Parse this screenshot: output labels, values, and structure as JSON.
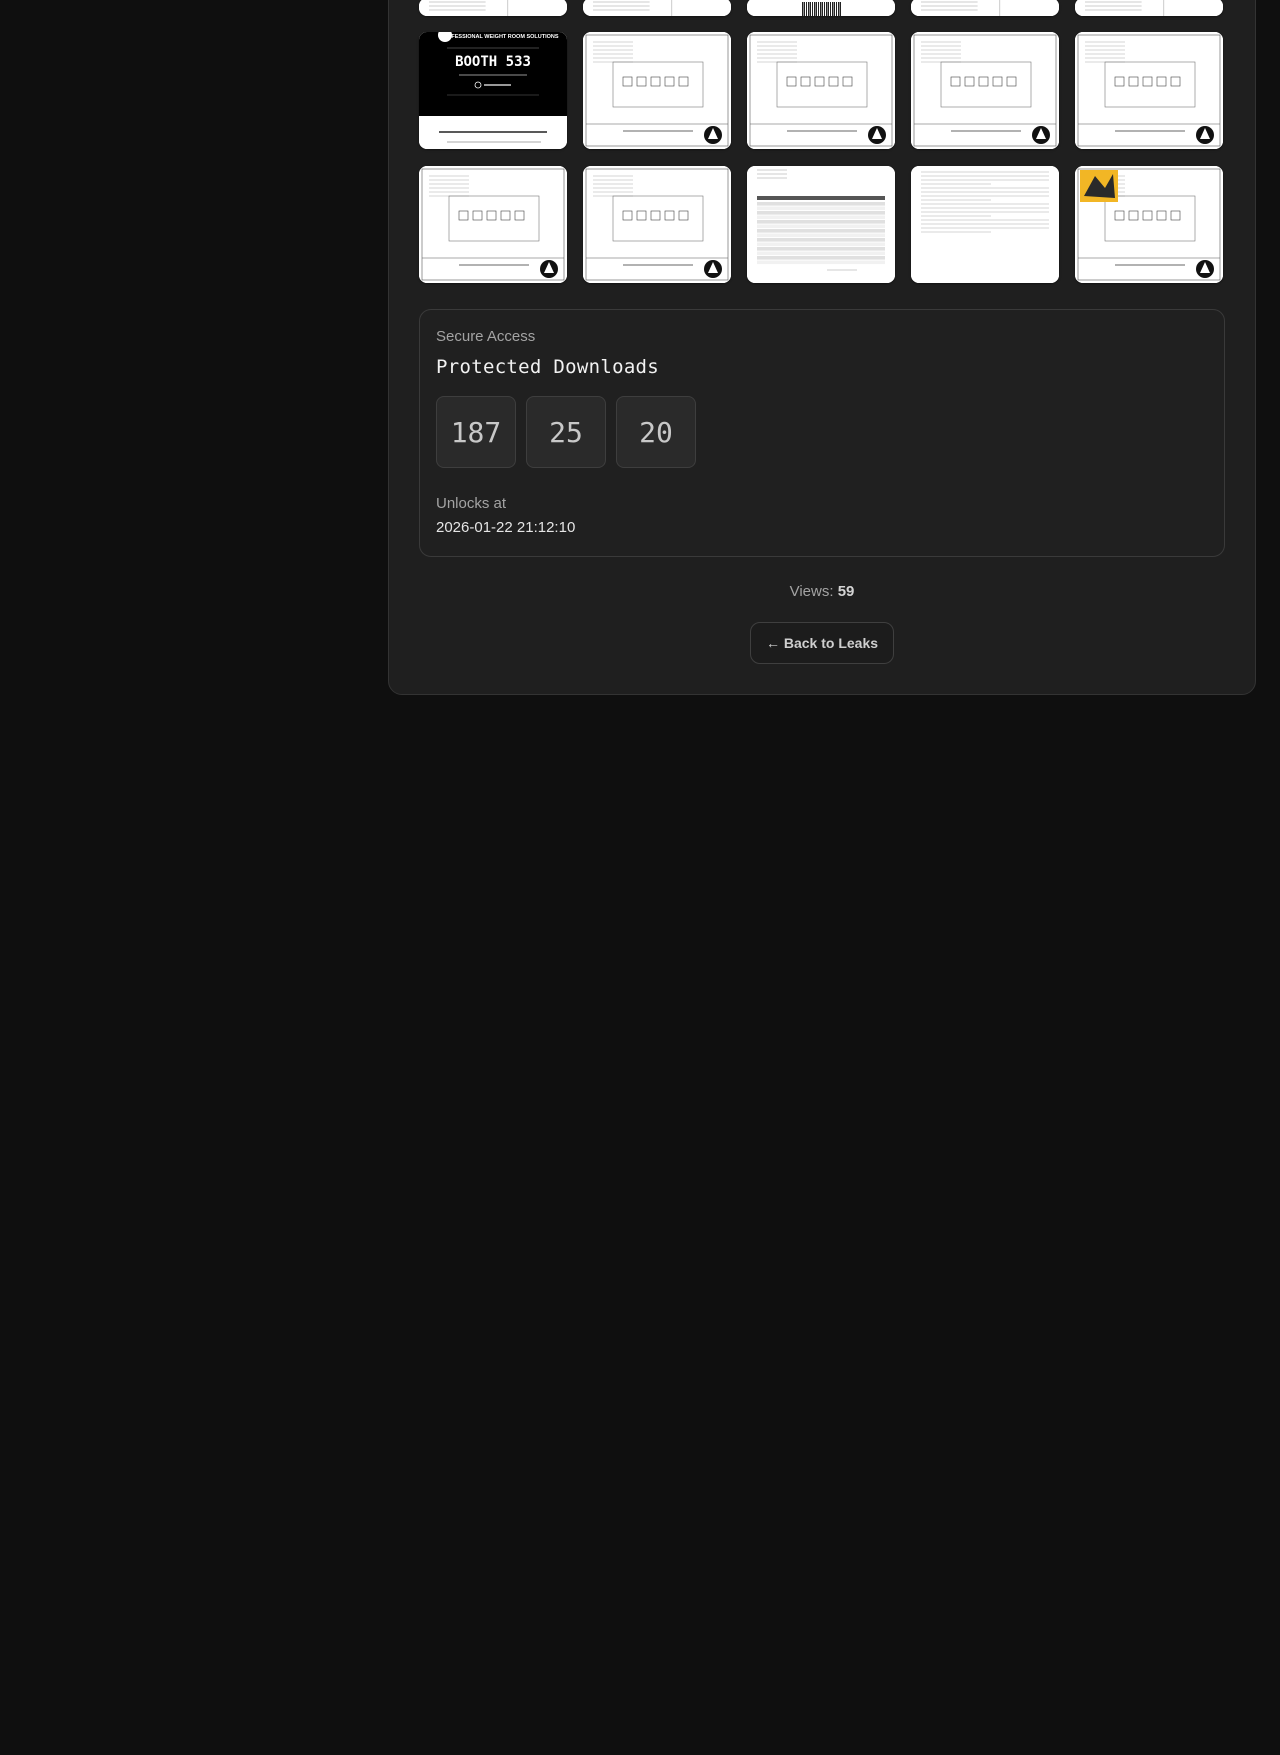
{
  "thumbnails": {
    "row1": [
      {
        "name": "doc-thumbnail-1",
        "kind": "sheet"
      },
      {
        "name": "doc-thumbnail-2",
        "kind": "sheet"
      },
      {
        "name": "doc-thumbnail-3",
        "kind": "barcode"
      },
      {
        "name": "doc-thumbnail-4",
        "kind": "sheet"
      },
      {
        "name": "doc-thumbnail-5",
        "kind": "sheet"
      }
    ],
    "row2": [
      {
        "name": "booth-flyer-thumbnail",
        "kind": "flyer",
        "top_text": "PROFESSIONAL WEIGHT ROOM SOLUTIONS",
        "headline": "BOOTH 533"
      },
      {
        "name": "floorplan-thumbnail-1",
        "kind": "floorplan"
      },
      {
        "name": "floorplan-thumbnail-2",
        "kind": "floorplan"
      },
      {
        "name": "floorplan-thumbnail-american-1",
        "kind": "floorplan"
      },
      {
        "name": "floorplan-thumbnail-american-2",
        "kind": "floorplan"
      }
    ],
    "row3": [
      {
        "name": "floorplan-thumbnail-appalachian",
        "kind": "floorplan"
      },
      {
        "name": "floorplan-thumbnail-auburn",
        "kind": "floorplan"
      },
      {
        "name": "quote-table-thumbnail",
        "kind": "table"
      },
      {
        "name": "letter-thumbnail",
        "kind": "letter"
      },
      {
        "name": "floorplan-thumbnail-missouri-western",
        "kind": "floorplan-logo"
      }
    ]
  },
  "secure": {
    "label": "Secure Access",
    "title": "Protected Downloads",
    "counters": [
      "187",
      "25",
      "20"
    ],
    "unlock_label": "Unlocks at",
    "unlock_time": "2026-01-22 21:12:10"
  },
  "views": {
    "label": "Views:",
    "count": "59"
  },
  "back_button": {
    "label": "← Back to Leaks"
  },
  "colors": {
    "background": "#0f0f0f",
    "panel": "#1f1f1f",
    "card_border": "#3a3a3a"
  }
}
